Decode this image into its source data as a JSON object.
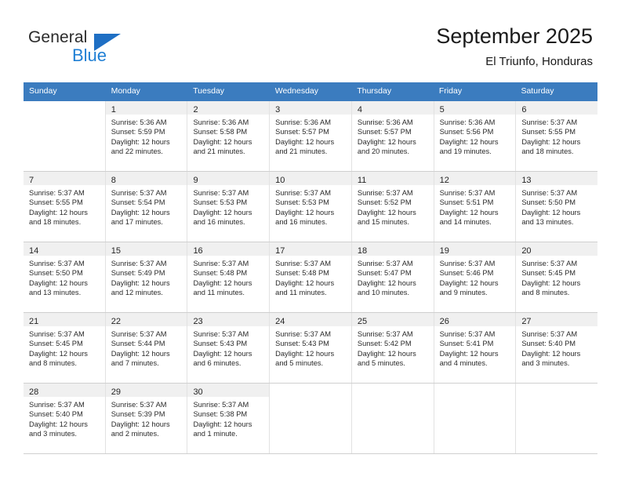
{
  "brand": {
    "name_top": "General",
    "name_bottom": "Blue",
    "accent_color": "#1f7fd4",
    "triangle_color": "#1f6fc4"
  },
  "header": {
    "title": "September 2025",
    "subtitle": "El Triunfo, Honduras"
  },
  "theme": {
    "header_row_bg": "#3b7cbf",
    "header_row_text": "#ffffff",
    "daynum_band_bg": "#f0f0f0",
    "grid_line": "#cfcfcf"
  },
  "weekdays": [
    "Sunday",
    "Monday",
    "Tuesday",
    "Wednesday",
    "Thursday",
    "Friday",
    "Saturday"
  ],
  "weeks": [
    [
      {
        "day": "",
        "sunrise": "",
        "sunset": "",
        "daylight_1": "",
        "daylight_2": ""
      },
      {
        "day": "1",
        "sunrise": "Sunrise: 5:36 AM",
        "sunset": "Sunset: 5:59 PM",
        "daylight_1": "Daylight: 12 hours",
        "daylight_2": "and 22 minutes."
      },
      {
        "day": "2",
        "sunrise": "Sunrise: 5:36 AM",
        "sunset": "Sunset: 5:58 PM",
        "daylight_1": "Daylight: 12 hours",
        "daylight_2": "and 21 minutes."
      },
      {
        "day": "3",
        "sunrise": "Sunrise: 5:36 AM",
        "sunset": "Sunset: 5:57 PM",
        "daylight_1": "Daylight: 12 hours",
        "daylight_2": "and 21 minutes."
      },
      {
        "day": "4",
        "sunrise": "Sunrise: 5:36 AM",
        "sunset": "Sunset: 5:57 PM",
        "daylight_1": "Daylight: 12 hours",
        "daylight_2": "and 20 minutes."
      },
      {
        "day": "5",
        "sunrise": "Sunrise: 5:36 AM",
        "sunset": "Sunset: 5:56 PM",
        "daylight_1": "Daylight: 12 hours",
        "daylight_2": "and 19 minutes."
      },
      {
        "day": "6",
        "sunrise": "Sunrise: 5:37 AM",
        "sunset": "Sunset: 5:55 PM",
        "daylight_1": "Daylight: 12 hours",
        "daylight_2": "and 18 minutes."
      }
    ],
    [
      {
        "day": "7",
        "sunrise": "Sunrise: 5:37 AM",
        "sunset": "Sunset: 5:55 PM",
        "daylight_1": "Daylight: 12 hours",
        "daylight_2": "and 18 minutes."
      },
      {
        "day": "8",
        "sunrise": "Sunrise: 5:37 AM",
        "sunset": "Sunset: 5:54 PM",
        "daylight_1": "Daylight: 12 hours",
        "daylight_2": "and 17 minutes."
      },
      {
        "day": "9",
        "sunrise": "Sunrise: 5:37 AM",
        "sunset": "Sunset: 5:53 PM",
        "daylight_1": "Daylight: 12 hours",
        "daylight_2": "and 16 minutes."
      },
      {
        "day": "10",
        "sunrise": "Sunrise: 5:37 AM",
        "sunset": "Sunset: 5:53 PM",
        "daylight_1": "Daylight: 12 hours",
        "daylight_2": "and 16 minutes."
      },
      {
        "day": "11",
        "sunrise": "Sunrise: 5:37 AM",
        "sunset": "Sunset: 5:52 PM",
        "daylight_1": "Daylight: 12 hours",
        "daylight_2": "and 15 minutes."
      },
      {
        "day": "12",
        "sunrise": "Sunrise: 5:37 AM",
        "sunset": "Sunset: 5:51 PM",
        "daylight_1": "Daylight: 12 hours",
        "daylight_2": "and 14 minutes."
      },
      {
        "day": "13",
        "sunrise": "Sunrise: 5:37 AM",
        "sunset": "Sunset: 5:50 PM",
        "daylight_1": "Daylight: 12 hours",
        "daylight_2": "and 13 minutes."
      }
    ],
    [
      {
        "day": "14",
        "sunrise": "Sunrise: 5:37 AM",
        "sunset": "Sunset: 5:50 PM",
        "daylight_1": "Daylight: 12 hours",
        "daylight_2": "and 13 minutes."
      },
      {
        "day": "15",
        "sunrise": "Sunrise: 5:37 AM",
        "sunset": "Sunset: 5:49 PM",
        "daylight_1": "Daylight: 12 hours",
        "daylight_2": "and 12 minutes."
      },
      {
        "day": "16",
        "sunrise": "Sunrise: 5:37 AM",
        "sunset": "Sunset: 5:48 PM",
        "daylight_1": "Daylight: 12 hours",
        "daylight_2": "and 11 minutes."
      },
      {
        "day": "17",
        "sunrise": "Sunrise: 5:37 AM",
        "sunset": "Sunset: 5:48 PM",
        "daylight_1": "Daylight: 12 hours",
        "daylight_2": "and 11 minutes."
      },
      {
        "day": "18",
        "sunrise": "Sunrise: 5:37 AM",
        "sunset": "Sunset: 5:47 PM",
        "daylight_1": "Daylight: 12 hours",
        "daylight_2": "and 10 minutes."
      },
      {
        "day": "19",
        "sunrise": "Sunrise: 5:37 AM",
        "sunset": "Sunset: 5:46 PM",
        "daylight_1": "Daylight: 12 hours",
        "daylight_2": "and 9 minutes."
      },
      {
        "day": "20",
        "sunrise": "Sunrise: 5:37 AM",
        "sunset": "Sunset: 5:45 PM",
        "daylight_1": "Daylight: 12 hours",
        "daylight_2": "and 8 minutes."
      }
    ],
    [
      {
        "day": "21",
        "sunrise": "Sunrise: 5:37 AM",
        "sunset": "Sunset: 5:45 PM",
        "daylight_1": "Daylight: 12 hours",
        "daylight_2": "and 8 minutes."
      },
      {
        "day": "22",
        "sunrise": "Sunrise: 5:37 AM",
        "sunset": "Sunset: 5:44 PM",
        "daylight_1": "Daylight: 12 hours",
        "daylight_2": "and 7 minutes."
      },
      {
        "day": "23",
        "sunrise": "Sunrise: 5:37 AM",
        "sunset": "Sunset: 5:43 PM",
        "daylight_1": "Daylight: 12 hours",
        "daylight_2": "and 6 minutes."
      },
      {
        "day": "24",
        "sunrise": "Sunrise: 5:37 AM",
        "sunset": "Sunset: 5:43 PM",
        "daylight_1": "Daylight: 12 hours",
        "daylight_2": "and 5 minutes."
      },
      {
        "day": "25",
        "sunrise": "Sunrise: 5:37 AM",
        "sunset": "Sunset: 5:42 PM",
        "daylight_1": "Daylight: 12 hours",
        "daylight_2": "and 5 minutes."
      },
      {
        "day": "26",
        "sunrise": "Sunrise: 5:37 AM",
        "sunset": "Sunset: 5:41 PM",
        "daylight_1": "Daylight: 12 hours",
        "daylight_2": "and 4 minutes."
      },
      {
        "day": "27",
        "sunrise": "Sunrise: 5:37 AM",
        "sunset": "Sunset: 5:40 PM",
        "daylight_1": "Daylight: 12 hours",
        "daylight_2": "and 3 minutes."
      }
    ],
    [
      {
        "day": "28",
        "sunrise": "Sunrise: 5:37 AM",
        "sunset": "Sunset: 5:40 PM",
        "daylight_1": "Daylight: 12 hours",
        "daylight_2": "and 3 minutes."
      },
      {
        "day": "29",
        "sunrise": "Sunrise: 5:37 AM",
        "sunset": "Sunset: 5:39 PM",
        "daylight_1": "Daylight: 12 hours",
        "daylight_2": "and 2 minutes."
      },
      {
        "day": "30",
        "sunrise": "Sunrise: 5:37 AM",
        "sunset": "Sunset: 5:38 PM",
        "daylight_1": "Daylight: 12 hours",
        "daylight_2": "and 1 minute."
      },
      {
        "day": "",
        "sunrise": "",
        "sunset": "",
        "daylight_1": "",
        "daylight_2": ""
      },
      {
        "day": "",
        "sunrise": "",
        "sunset": "",
        "daylight_1": "",
        "daylight_2": ""
      },
      {
        "day": "",
        "sunrise": "",
        "sunset": "",
        "daylight_1": "",
        "daylight_2": ""
      },
      {
        "day": "",
        "sunrise": "",
        "sunset": "",
        "daylight_1": "",
        "daylight_2": ""
      }
    ]
  ]
}
